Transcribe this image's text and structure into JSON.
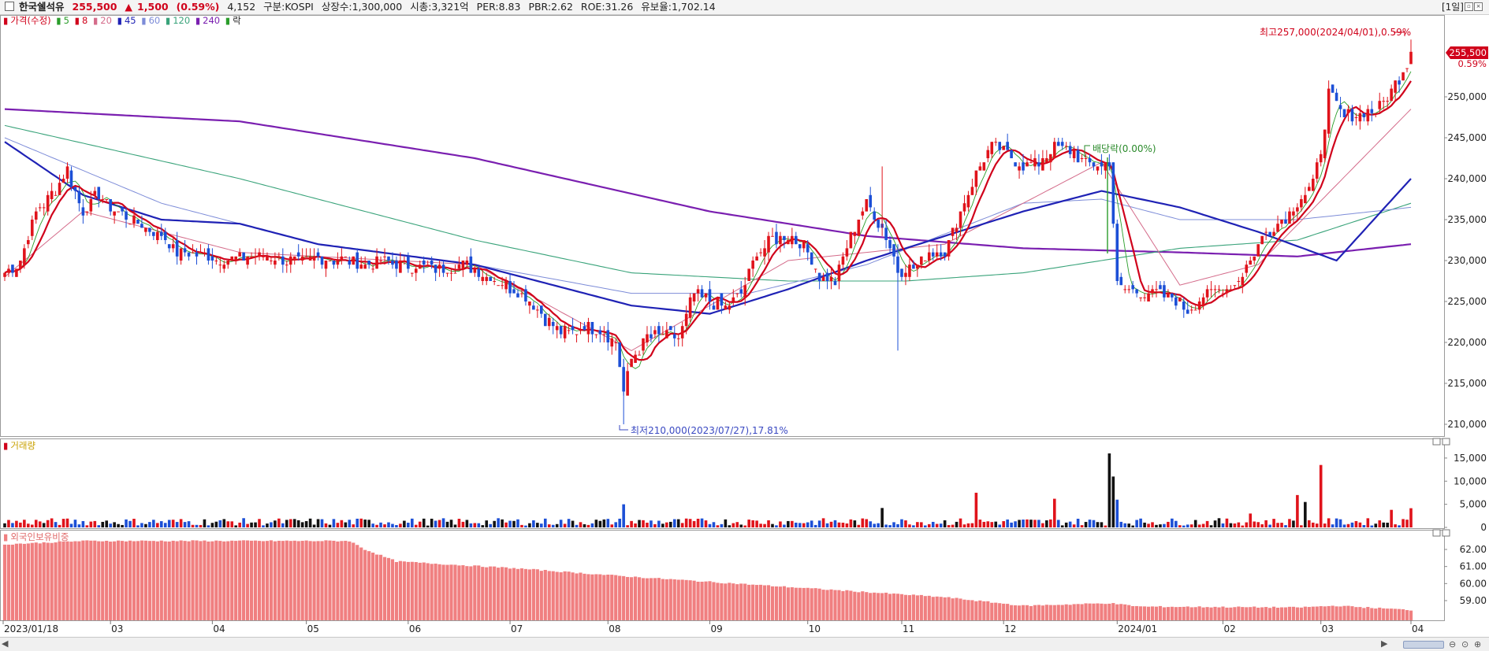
{
  "header": {
    "name": "한국쉘석유",
    "price": "255,500",
    "change_arrow": "▲",
    "change": "1,500",
    "change_pct": "(0.59%)",
    "volume": "4,152",
    "market": "구분:KOSPI",
    "shares": "상장수:1,300,000",
    "mcap": "시총:3,321억",
    "per": "PER:8.83",
    "pbr": "PBR:2.62",
    "roe": "ROE:31.26",
    "float": "유보율:1,702.14",
    "period": "[1일]"
  },
  "legend": {
    "price": "가격(수정)",
    "ma5": "5",
    "ma8": "8",
    "ma20": "20",
    "ma45": "45",
    "ma60": "60",
    "ma120": "120",
    "ma240": "240",
    "drop": "락"
  },
  "annotations": {
    "high": "최고257,000(2024/04/01),0.59%",
    "low": "최저210,000(2023/07/27),17.81%",
    "dividend": "배당락(0.00%)",
    "last_price_tag": "255,500",
    "last_pct_tag": "0.59%"
  },
  "volume_panel": {
    "title": "거래량"
  },
  "foreign_panel": {
    "title": "외국인보유비중"
  },
  "x_axis": {
    "labels": [
      "2023/01/18",
      "03",
      "04",
      "05",
      "06",
      "07",
      "08",
      "09",
      "10",
      "11",
      "12",
      "2024/01",
      "02",
      "03",
      "04"
    ]
  },
  "colors": {
    "up": "#e0131b",
    "down": "#1c4fd6",
    "ma5": "#d0021b",
    "ma20": "#d46b8a",
    "ma45": "#1f22b5",
    "ma60": "#7d8cd8",
    "ma120": "#39a37a",
    "ma240": "#7a1fb0",
    "foreign": "#f07f80"
  },
  "chart_data": [
    {
      "type": "candlestick",
      "title": "한국쉘석유 가격(수정)",
      "y_ticks": [
        210000,
        215000,
        220000,
        225000,
        230000,
        235000,
        240000,
        245000,
        250000
      ],
      "y_tick_labels": [
        "210,000",
        "215,000",
        "220,000",
        "225,000",
        "230,000",
        "235,000",
        "240,000",
        "245,000",
        "250,000"
      ],
      "ylim": [
        209000,
        260000
      ],
      "close_anchors": [
        [
          0,
          228500
        ],
        [
          4,
          230000
        ],
        [
          8,
          236000
        ],
        [
          12,
          238000
        ],
        [
          16,
          241000
        ],
        [
          20,
          236000
        ],
        [
          24,
          238000
        ],
        [
          28,
          236000
        ],
        [
          32,
          235000
        ],
        [
          36,
          234000
        ],
        [
          40,
          233000
        ],
        [
          44,
          231000
        ],
        [
          48,
          231000
        ],
        [
          52,
          230500
        ],
        [
          56,
          230000
        ],
        [
          60,
          230500
        ],
        [
          64,
          230500
        ],
        [
          68,
          230500
        ],
        [
          72,
          230000
        ],
        [
          76,
          230000
        ],
        [
          80,
          230500
        ],
        [
          84,
          230000
        ],
        [
          88,
          230000
        ],
        [
          92,
          229500
        ],
        [
          96,
          230000
        ],
        [
          100,
          229500
        ],
        [
          104,
          229500
        ],
        [
          108,
          229000
        ],
        [
          112,
          229000
        ],
        [
          116,
          229500
        ],
        [
          120,
          229000
        ],
        [
          124,
          228000
        ],
        [
          128,
          227000
        ],
        [
          132,
          226000
        ],
        [
          136,
          224000
        ],
        [
          140,
          222000
        ],
        [
          144,
          221000
        ],
        [
          148,
          222000
        ],
        [
          152,
          221500
        ],
        [
          156,
          220000
        ],
        [
          158,
          214000
        ],
        [
          160,
          218000
        ],
        [
          164,
          220500
        ],
        [
          168,
          221000
        ],
        [
          172,
          220500
        ],
        [
          176,
          226000
        ],
        [
          180,
          225000
        ],
        [
          184,
          224500
        ],
        [
          188,
          226000
        ],
        [
          192,
          231000
        ],
        [
          196,
          232500
        ],
        [
          200,
          233000
        ],
        [
          204,
          232000
        ],
        [
          208,
          228000
        ],
        [
          212,
          227500
        ],
        [
          216,
          233000
        ],
        [
          220,
          237000
        ],
        [
          224,
          234000
        ],
        [
          228,
          229000
        ],
        [
          232,
          229000
        ],
        [
          236,
          231000
        ],
        [
          240,
          231000
        ],
        [
          244,
          236000
        ],
        [
          248,
          240500
        ],
        [
          252,
          244000
        ],
        [
          256,
          243000
        ],
        [
          260,
          241500
        ],
        [
          264,
          242000
        ],
        [
          268,
          244000
        ],
        [
          272,
          243500
        ],
        [
          276,
          242000
        ],
        [
          280,
          241500
        ],
        [
          282,
          242000
        ],
        [
          284,
          227000
        ],
        [
          286,
          226500
        ],
        [
          290,
          226000
        ],
        [
          294,
          226000
        ],
        [
          298,
          225500
        ],
        [
          302,
          224000
        ],
        [
          306,
          225500
        ],
        [
          310,
          226500
        ],
        [
          314,
          227000
        ],
        [
          318,
          230000
        ],
        [
          322,
          233500
        ],
        [
          326,
          235000
        ],
        [
          330,
          237000
        ],
        [
          334,
          239500
        ],
        [
          336,
          243500
        ],
        [
          338,
          250500
        ],
        [
          342,
          247500
        ],
        [
          346,
          248000
        ],
        [
          350,
          248500
        ],
        [
          354,
          250500
        ],
        [
          356,
          252500
        ],
        [
          358,
          254000
        ],
        [
          359,
          255500
        ]
      ],
      "ma_anchors": {
        "ma20": [
          [
            0,
            228000
          ],
          [
            20,
            236000
          ],
          [
            60,
            231000
          ],
          [
            120,
            229500
          ],
          [
            160,
            219000
          ],
          [
            200,
            230000
          ],
          [
            240,
            232000
          ],
          [
            280,
            242000
          ],
          [
            300,
            227000
          ],
          [
            320,
            229500
          ],
          [
            359,
            248500
          ]
        ],
        "ma45": [
          [
            0,
            244500
          ],
          [
            20,
            238000
          ],
          [
            40,
            235000
          ],
          [
            60,
            234500
          ],
          [
            80,
            232000
          ],
          [
            120,
            229500
          ],
          [
            140,
            227000
          ],
          [
            160,
            224500
          ],
          [
            180,
            223500
          ],
          [
            200,
            226500
          ],
          [
            220,
            230000
          ],
          [
            240,
            233000
          ],
          [
            260,
            236000
          ],
          [
            280,
            238500
          ],
          [
            300,
            236500
          ],
          [
            320,
            233500
          ],
          [
            340,
            230000
          ],
          [
            359,
            240000
          ]
        ],
        "ma60": [
          [
            0,
            245000
          ],
          [
            40,
            237000
          ],
          [
            80,
            232000
          ],
          [
            120,
            229500
          ],
          [
            160,
            226000
          ],
          [
            190,
            226000
          ],
          [
            220,
            229500
          ],
          [
            260,
            237000
          ],
          [
            280,
            237500
          ],
          [
            300,
            235000
          ],
          [
            330,
            235000
          ],
          [
            359,
            236500
          ]
        ],
        "ma120": [
          [
            0,
            246500
          ],
          [
            60,
            240000
          ],
          [
            120,
            232500
          ],
          [
            160,
            228500
          ],
          [
            200,
            227500
          ],
          [
            230,
            227500
          ],
          [
            260,
            228500
          ],
          [
            300,
            231500
          ],
          [
            330,
            232500
          ],
          [
            359,
            237000
          ]
        ],
        "ma240": [
          [
            0,
            248500
          ],
          [
            60,
            247000
          ],
          [
            120,
            242500
          ],
          [
            180,
            236000
          ],
          [
            220,
            233000
          ],
          [
            260,
            231500
          ],
          [
            300,
            231000
          ],
          [
            330,
            230500
          ],
          [
            359,
            232000
          ]
        ]
      }
    },
    {
      "type": "bar",
      "title": "거래량",
      "y_ticks": [
        0,
        5000,
        10000,
        15000
      ],
      "y_tick_labels": [
        "0",
        "5,000",
        "10,000",
        "15,000"
      ],
      "spikes": [
        [
          158,
          5000
        ],
        [
          224,
          4200
        ],
        [
          248,
          7500
        ],
        [
          268,
          6200
        ],
        [
          282,
          16000
        ],
        [
          283,
          11000
        ],
        [
          284,
          6000
        ],
        [
          318,
          3000
        ],
        [
          330,
          7000
        ],
        [
          332,
          5500
        ],
        [
          336,
          13500
        ],
        [
          354,
          3800
        ],
        [
          359,
          4152
        ]
      ]
    },
    {
      "type": "bar",
      "title": "외국인보유비중",
      "y_ticks": [
        59,
        60,
        61,
        62
      ],
      "y_tick_labels": [
        "59.00",
        "60.00",
        "61.00",
        "62.00"
      ],
      "ylim": [
        58.2,
        62.9
      ],
      "anchors": [
        [
          0,
          62.3
        ],
        [
          20,
          62.5
        ],
        [
          88,
          62.5
        ],
        [
          92,
          62.0
        ],
        [
          100,
          61.3
        ],
        [
          130,
          60.9
        ],
        [
          160,
          60.4
        ],
        [
          200,
          59.8
        ],
        [
          240,
          59.2
        ],
        [
          260,
          58.7
        ],
        [
          282,
          58.85
        ],
        [
          290,
          58.65
        ],
        [
          330,
          58.6
        ],
        [
          340,
          58.7
        ],
        [
          359,
          58.45
        ]
      ]
    }
  ]
}
